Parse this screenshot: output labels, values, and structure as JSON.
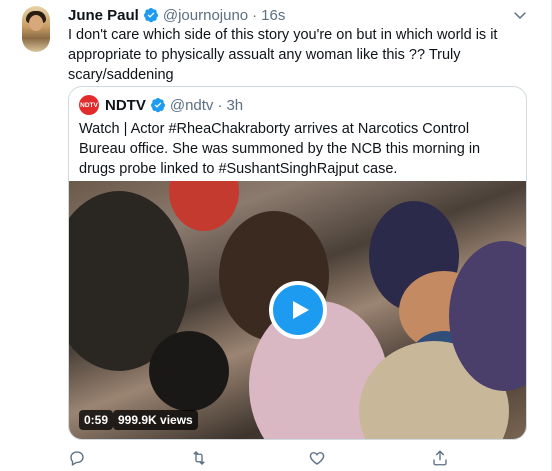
{
  "tweet": {
    "author_name": "June Paul",
    "handle": "@journojuno",
    "separator": "·",
    "time": "16s",
    "text": "I don't care which side of this story you're on but in which world is it appropriate to physically assualt any woman like this ?? Truly scary/saddening"
  },
  "quoted": {
    "logo_text": "NDTV",
    "author_name": "NDTV",
    "handle": "@ndtv",
    "separator": "·",
    "time": "3h",
    "text": "Watch | Actor #RheaChakraborty arrives at Narcotics Control Bureau office. She was summoned by the NCB this morning  in drugs probe linked to #SushantSinghRajput case.",
    "video": {
      "duration": "0:59",
      "views": "999.9K views"
    }
  },
  "icons": {
    "verified": "verified-badge-icon",
    "more": "chevron-down-icon",
    "reply": "reply-icon",
    "retweet": "retweet-icon",
    "like": "like-icon",
    "share": "share-icon",
    "play": "play-icon"
  },
  "colors": {
    "accent": "#1d9bf0",
    "secondary_text": "#5b7083",
    "border": "#cfd9de",
    "ndtv_red": "#e22b2b"
  }
}
